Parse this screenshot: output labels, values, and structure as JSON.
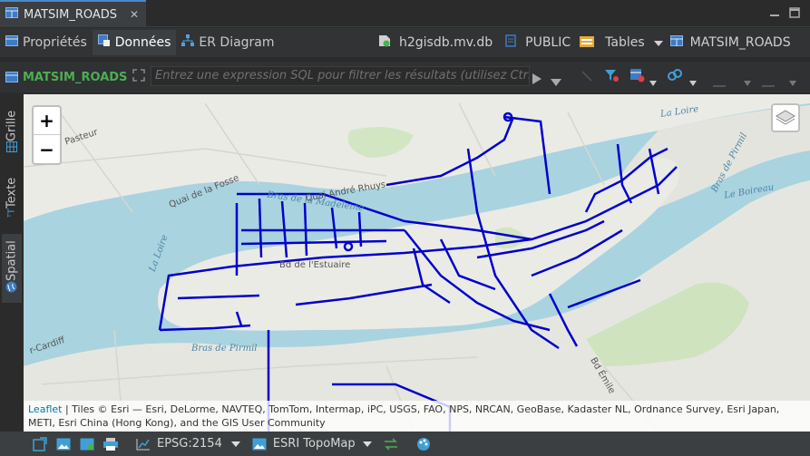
{
  "editor_tab": {
    "title": "MATSIM_ROADS",
    "close": "✕"
  },
  "sub_tabs": [
    {
      "label": "Propriétés"
    },
    {
      "label": "Données"
    },
    {
      "label": "ER Diagram"
    }
  ],
  "breadcrumb": {
    "database": "h2gisdb.mv.db",
    "schema": "PUBLIC",
    "tables": "Tables",
    "table": "MATSIM_ROADS"
  },
  "filter": {
    "table_label": "MATSIM_ROADS",
    "placeholder": "Entrez une expression SQL pour filtrer les résultats (utilisez Ctrl+Espace)"
  },
  "side_tabs": [
    {
      "label": "Grille"
    },
    {
      "label": "Texte"
    },
    {
      "label": "Spatial"
    }
  ],
  "map": {
    "zoom_in": "+",
    "zoom_out": "−",
    "labels": {
      "la_loire_1": "La Loire",
      "la_loire_2": "La Loire",
      "bras_madeleine": "Bras de la Madeleine",
      "bras_pirmil_1": "Bras de Pirmil",
      "bras_pirmil_2": "Bras de Pirmil",
      "le_boireau": "Le Boireau",
      "quai_fosse": "Quai de la Fosse",
      "quai_andre": "Quai André Rhuys",
      "bd_estuaire": "Bd de l'Estuaire",
      "pasteur": "Pasteur",
      "cardiff": "r-Cardiff",
      "bd_emile": "Bd Émile"
    },
    "attribution_link": "Leaflet",
    "attribution_text": " | Tiles © Esri — Esri, DeLorme, NAVTEQ, TomTom, Intermap, iPC, USGS, FAO, NPS, NRCAN, GeoBase, Kadaster NL, Ordnance Survey, Esri Japan, METI, Esri China (Hong Kong), and the GIS User Community"
  },
  "status_bar": {
    "crs": "EPSG:2154",
    "basemap": "ESRI TopoMap"
  },
  "colors": {
    "roads": "#0000cc",
    "water": "#a9d3df",
    "land": "#ebebe6",
    "accent": "#4a88c7"
  }
}
